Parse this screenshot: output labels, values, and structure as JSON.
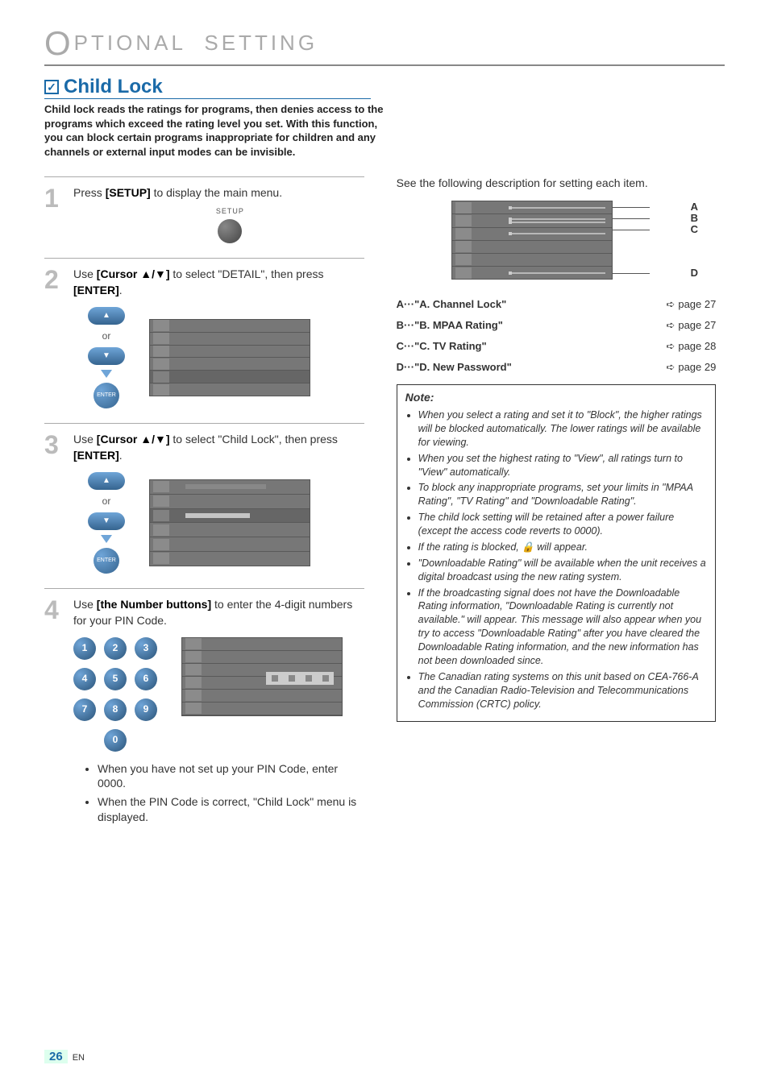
{
  "header": {
    "title_rest": "PTIONAL",
    "title_word2": "SETTING"
  },
  "section": {
    "title": "Child Lock",
    "intro": "Child lock reads the ratings for programs, then denies access to the programs which exceed the rating level you set. With this function, you can block certain programs inappropriate for children and any channels or external input modes can be invisible."
  },
  "steps": {
    "s1": {
      "pre": "Press ",
      "bold": "[SETUP]",
      "post": " to display the main menu.",
      "setup_label": "SETUP"
    },
    "s2": {
      "pre": "Use ",
      "bold": "[Cursor ▲/▼]",
      "mid": " to select \"DETAIL\", then press ",
      "bold2": "[ENTER]",
      "post": ".",
      "or": "or",
      "enter": "ENTER"
    },
    "s3": {
      "pre": "Use ",
      "bold": "[Cursor ▲/▼]",
      "mid": " to select \"Child Lock\", then press ",
      "bold2": "[ENTER]",
      "post": ".",
      "or": "or",
      "enter": "ENTER"
    },
    "s4": {
      "pre": "Use ",
      "bold": "[the Number buttons]",
      "post": " to enter the 4-digit numbers for your PIN Code.",
      "keys": [
        "1",
        "2",
        "3",
        "4",
        "5",
        "6",
        "7",
        "8",
        "9",
        "",
        "0",
        ""
      ],
      "bullets": [
        "When you have not set up your PIN Code, enter 0000.",
        "When the PIN Code is correct, \"Child Lock\" menu is displayed."
      ]
    }
  },
  "right": {
    "intro": "See the following description for setting each item.",
    "callouts": {
      "a": "A",
      "b": "B",
      "c": "C",
      "d": "D"
    },
    "items": [
      {
        "prefix": "A···",
        "name": "\"A. Channel Lock\"",
        "page": "page 27"
      },
      {
        "prefix": "B···",
        "name": "\"B. MPAA Rating\"",
        "page": "page 27"
      },
      {
        "prefix": "C···",
        "name": "\"C. TV Rating\"",
        "page": "page 28"
      },
      {
        "prefix": "D···",
        "name": "\"D. New Password\"",
        "page": "page 29"
      }
    ],
    "note_title": "Note:",
    "notes": [
      "When you select a rating and set it to \"Block\", the higher ratings will be blocked automatically. The lower ratings will be available for viewing.",
      "When you set the highest rating to \"View\", all ratings turn to \"View\" automatically.",
      "To block any inappropriate programs, set your limits in \"MPAA Rating\", \"TV Rating\" and \"Downloadable  Rating\".",
      "The child lock setting will be retained after a power failure (except the access code reverts to 0000).",
      "If the rating is blocked, 🔒 will appear.",
      "\"Downloadable  Rating\" will be available when the unit receives a digital broadcast using the new rating system.",
      "If the broadcasting signal does not have the Downloadable  Rating information, \"Downloadable Rating is currently not available.\" will appear. This message will also appear when you try to access \"Downloadable  Rating\" after you have cleared the Downloadable  Rating information, and the new information has not been downloaded since.",
      "The Canadian rating systems on this unit based on CEA-766-A and the Canadian Radio-Television and Telecommunications Commission (CRTC) policy."
    ]
  },
  "footer": {
    "page_number": "26",
    "lang": "EN"
  }
}
